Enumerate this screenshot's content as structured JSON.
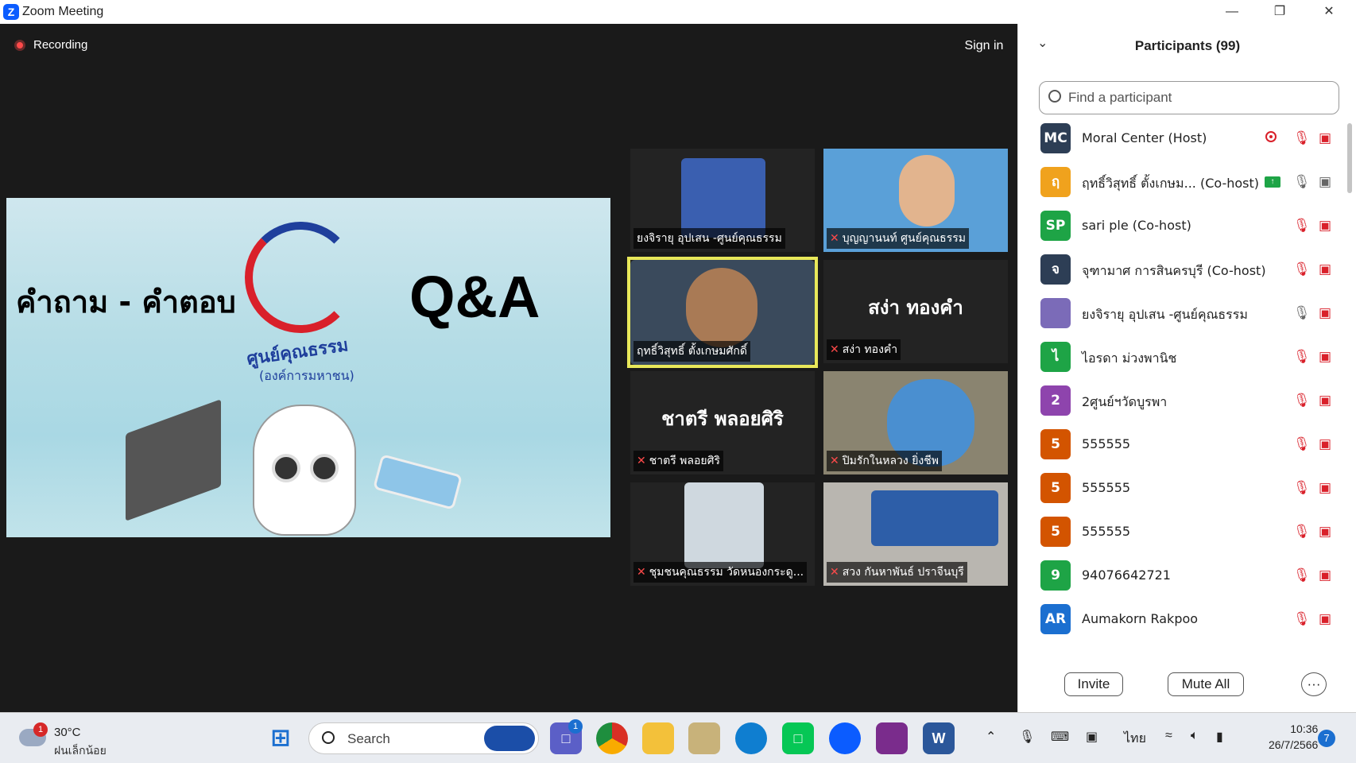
{
  "window": {
    "title": "Zoom Meeting"
  },
  "meeting": {
    "recording_label": "Recording",
    "sign_in_label": "Sign in",
    "slide": {
      "thai_title": "คำถาม - คำตอบ",
      "qa_title": "Q&A",
      "logo_text": "ศูนย์คุณธรรม",
      "logo_sub": "(องค์การมหาชน)"
    },
    "tiles": [
      {
        "caption": "ยงจิรายุ อุปเสน -ศูนย์คุณธรรม",
        "muted": false,
        "active": false,
        "kind": "video"
      },
      {
        "caption": "บุญญานนท์ ศูนย์คุณธรรม",
        "muted": true,
        "active": false,
        "kind": "video"
      },
      {
        "caption": "ฤทธิ์วิสุทธิ์ ตั้งเกษมศักดิ์",
        "muted": false,
        "active": true,
        "kind": "video"
      },
      {
        "caption": "สง่า ทองคำ",
        "muted": true,
        "active": false,
        "kind": "name",
        "big_name": "สง่า ทองคำ"
      },
      {
        "caption": "ชาตรี พลอยศิริ",
        "muted": true,
        "active": false,
        "kind": "name",
        "big_name": "ชาตรี พลอยศิริ"
      },
      {
        "caption": "ปิมรักในหลวง ยิ่งชีพ",
        "muted": true,
        "active": false,
        "kind": "video"
      },
      {
        "caption": "ชุมชนคุณธรรม วัดหนองกระดู...",
        "muted": true,
        "active": false,
        "kind": "video"
      },
      {
        "caption": "สวง กันหาพันธ์ ปราจีนบุรี",
        "muted": true,
        "active": false,
        "kind": "video"
      }
    ]
  },
  "participants": {
    "header": "Participants (99)",
    "search_placeholder": "Find a participant",
    "list": [
      {
        "initials": "MC",
        "name": "Moral Center (Host)",
        "color": "#2d3e55",
        "mic": "muted",
        "cam": "off",
        "recording": true
      },
      {
        "initials": "ฤ",
        "name": "ฤทธิ์วิสุทธิ์ ตั้งเกษม...    (Co-host)",
        "color": "#f0a21d",
        "mic": "on",
        "cam": "on",
        "sharing": true
      },
      {
        "initials": "SP",
        "name": "sari ple (Co-host)",
        "color": "#1ea446",
        "mic": "muted",
        "cam": "off"
      },
      {
        "initials": "จ",
        "name": "จุฑามาศ การสินครบุรี (Co-host)",
        "color": "#2d3e55",
        "mic": "muted",
        "cam": "off"
      },
      {
        "initials": "",
        "name": "ยงจิรายุ อุปเสน -ศูนย์คุณธรรม",
        "color": "#7b6bb8",
        "mic": "on",
        "cam": "off",
        "photo": true
      },
      {
        "initials": "ไ",
        "name": "ไอรดา ม่วงพานิช",
        "color": "#1ea446",
        "mic": "muted",
        "cam": "off"
      },
      {
        "initials": "2",
        "name": "2ศูนย์ฯวัดบูรพา",
        "color": "#8e44ad",
        "mic": "muted",
        "cam": "off"
      },
      {
        "initials": "5",
        "name": "555555",
        "color": "#d35400",
        "mic": "muted",
        "cam": "off"
      },
      {
        "initials": "5",
        "name": "555555",
        "color": "#d35400",
        "mic": "muted",
        "cam": "off"
      },
      {
        "initials": "5",
        "name": "555555",
        "color": "#d35400",
        "mic": "muted",
        "cam": "off"
      },
      {
        "initials": "9",
        "name": "94076642721",
        "color": "#1ea446",
        "mic": "muted",
        "cam": "off"
      },
      {
        "initials": "AR",
        "name": "Aumakorn Rakpoo",
        "color": "#1b6fd0",
        "mic": "muted",
        "cam": "off"
      }
    ],
    "invite_label": "Invite",
    "mute_all_label": "Mute All",
    "more_label": "···"
  },
  "taskbar": {
    "weather_badge": "1",
    "temperature": "30°C",
    "condition": "ฝนเล็กน้อย",
    "search_label": "Search",
    "teams_badge": "1",
    "language": "ไทย",
    "time": "10:36",
    "date": "26/7/2566",
    "notification_count": "7"
  }
}
